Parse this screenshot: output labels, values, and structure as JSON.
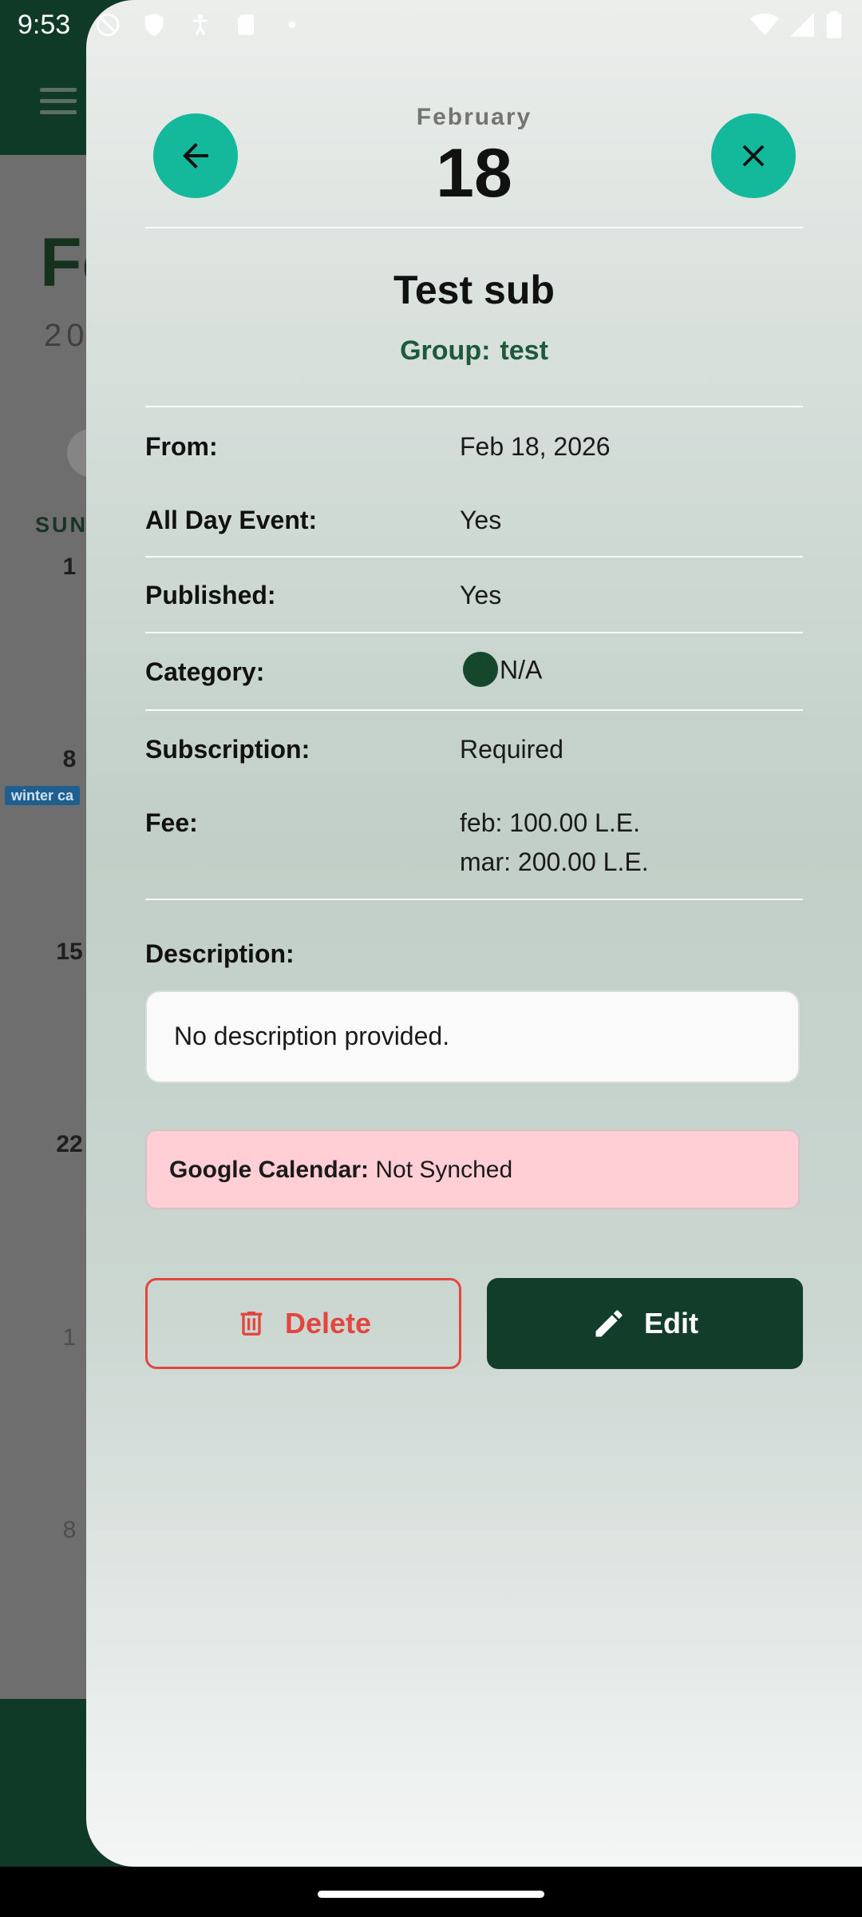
{
  "status_bar": {
    "time": "9:53"
  },
  "background_calendar": {
    "month_partial": "Fe",
    "year_partial": "20",
    "weekday_header": "SUN",
    "days": [
      "1",
      "8",
      "15",
      "22",
      "1",
      "8"
    ],
    "event_tag": "winter ca"
  },
  "sheet": {
    "month": "February",
    "day": "18",
    "title": "Test sub",
    "group_label": "Group:",
    "group_value": "test",
    "rows": {
      "from": {
        "label": "From:",
        "value": "Feb 18, 2026"
      },
      "all_day": {
        "label": "All Day Event:",
        "value": "Yes"
      },
      "published": {
        "label": "Published:",
        "value": "Yes"
      },
      "category": {
        "label": "Category:",
        "value": "N/A",
        "color": "#15472d"
      },
      "subscription": {
        "label": "Subscription:",
        "value": "Required"
      },
      "fee": {
        "label": "Fee:",
        "line1": "feb: 100.00 L.E.",
        "line2": "mar: 200.00 L.E."
      }
    },
    "description_label": "Description:",
    "description_text": "No description provided.",
    "google_calendar_label": "Google Calendar:",
    "google_calendar_status": "Not Synched",
    "delete_label": "Delete",
    "edit_label": "Edit"
  },
  "colors": {
    "accent_teal": "#14b89a",
    "primary_green": "#133d2b",
    "danger_red": "#e2463f",
    "sync_bg": "#ffcfd5"
  },
  "icons": [
    "back-arrow-icon",
    "close-icon",
    "trash-icon",
    "pencil-icon",
    "menu-icon"
  ]
}
